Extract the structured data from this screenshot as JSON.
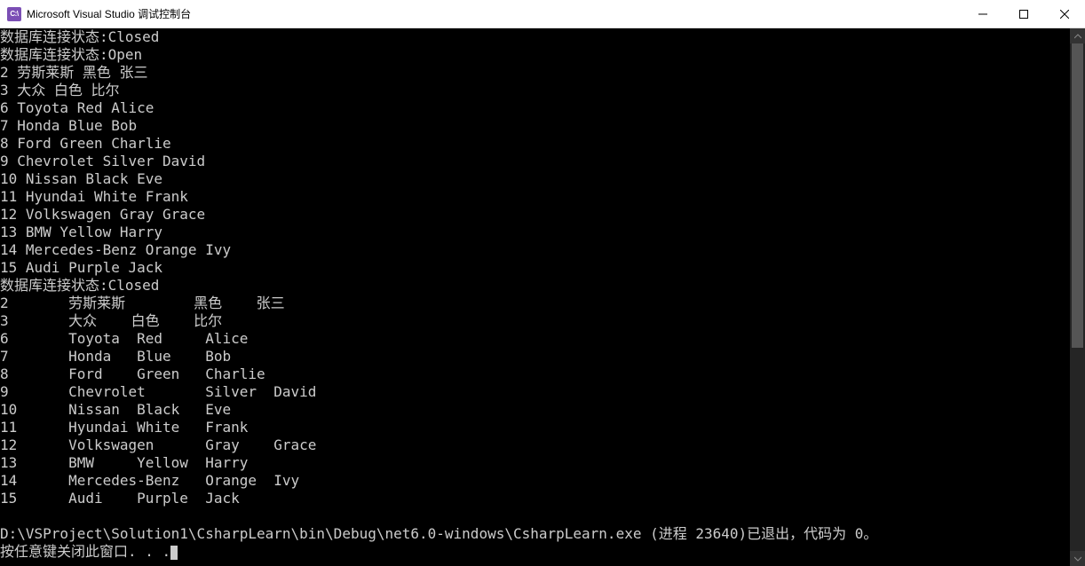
{
  "window": {
    "icon_label": "C:\\",
    "title": "Microsoft Visual Studio 调试控制台"
  },
  "console": {
    "lines": [
      "数据库连接状态:Closed",
      "数据库连接状态:Open",
      "2 劳斯莱斯 黑色 张三",
      "3 大众 白色 比尔",
      "6 Toyota Red Alice",
      "7 Honda Blue Bob",
      "8 Ford Green Charlie",
      "9 Chevrolet Silver David",
      "10 Nissan Black Eve",
      "11 Hyundai White Frank",
      "12 Volkswagen Gray Grace",
      "13 BMW Yellow Harry",
      "14 Mercedes-Benz Orange Ivy",
      "15 Audi Purple Jack",
      "数据库连接状态:Closed",
      "2       劳斯莱斯        黑色    张三",
      "3       大众    白色    比尔",
      "6       Toyota  Red     Alice",
      "7       Honda   Blue    Bob",
      "8       Ford    Green   Charlie",
      "9       Chevrolet       Silver  David",
      "10      Nissan  Black   Eve",
      "11      Hyundai White   Frank",
      "12      Volkswagen      Gray    Grace",
      "13      BMW     Yellow  Harry",
      "14      Mercedes-Benz   Orange  Ivy",
      "15      Audi    Purple  Jack",
      "",
      "D:\\VSProject\\Solution1\\CsharpLearn\\bin\\Debug\\net6.0-windows\\CsharpLearn.exe (进程 23640)已退出，代码为 0。",
      "按任意键关闭此窗口. . ."
    ]
  }
}
